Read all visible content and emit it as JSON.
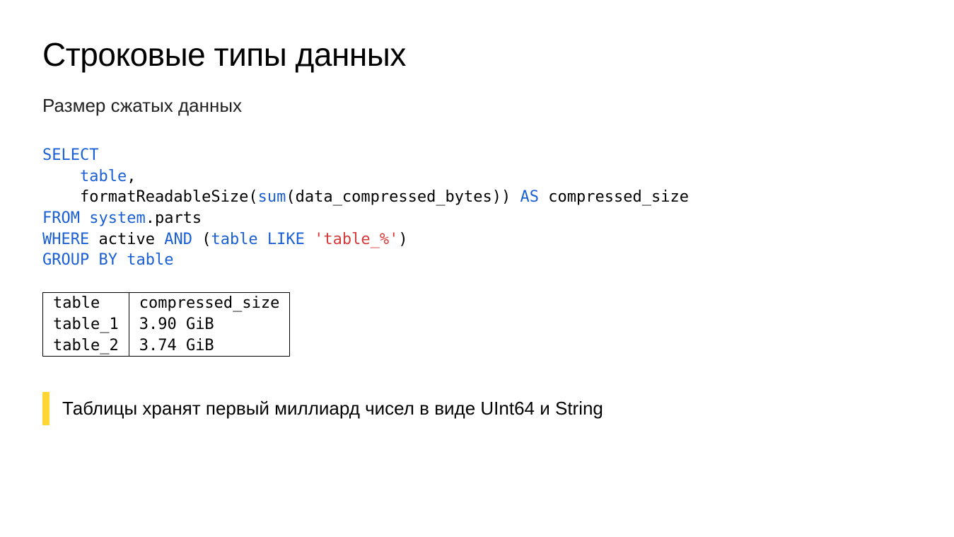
{
  "title": "Строковые типы данных",
  "subtitle": "Размер сжатых данных",
  "sql": {
    "kw_select": "SELECT",
    "indent1": "    ",
    "tok_table": "table",
    "tok_comma": ",",
    "line2_pre": "    formatReadableSize(",
    "fn_sum": "sum",
    "line2_mid": "(data_compressed_bytes)) ",
    "kw_as": "AS",
    "line2_tail": " compressed_size",
    "kw_from": "FROM",
    "tok_system": " system",
    "tok_parts": ".parts",
    "kw_where": "WHERE",
    "tok_active": " active ",
    "kw_and": "AND",
    "tok_paren_open": " (",
    "tok_table2": "table",
    "kw_like": " LIKE ",
    "str_like": "'table_%'",
    "tok_paren_close": ")",
    "kw_group": "GROUP",
    "kw_by": " BY ",
    "tok_table3": "table"
  },
  "result": {
    "headers": [
      "table",
      "compressed_size"
    ],
    "rows": [
      [
        "table_1",
        "3.90 GiB"
      ],
      [
        "table_2",
        "3.74 GiB"
      ]
    ]
  },
  "callout": "Таблицы хранят первый миллиард чисел в виде UInt64 и String"
}
